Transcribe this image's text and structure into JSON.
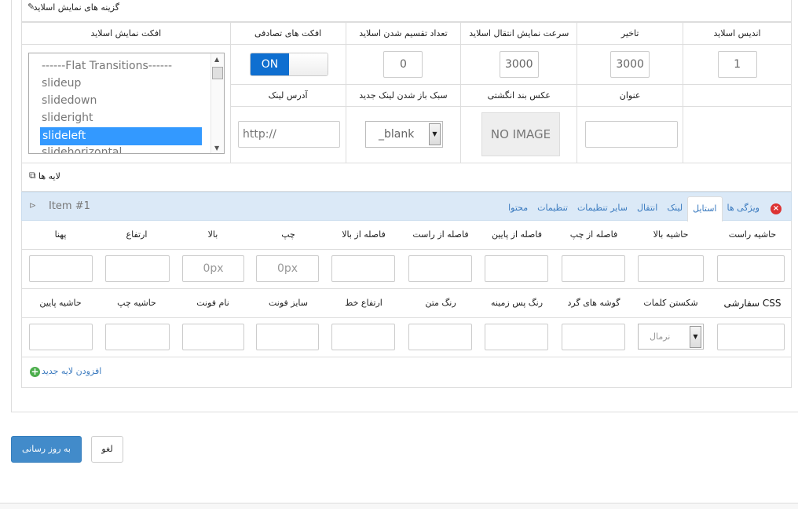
{
  "section": {
    "title": "گزینه های نمایش اسلاید",
    "icon": "wrench-icon"
  },
  "top_headers": [
    "اندیس اسلاید",
    "تاخیر",
    "سرعت نمایش انتقال اسلاید",
    "تعداد تقسیم شدن اسلاید",
    "افکت های تصادفی",
    "افکت نمایش اسلاید"
  ],
  "top_values": {
    "slide_index": "1",
    "delay": "3000",
    "transition_speed": "3000",
    "slices": "0"
  },
  "toggle": {
    "on_label": "ON"
  },
  "effects_list": [
    "------Flat Transitions------",
    "slideup",
    "slidedown",
    "slideright",
    "slideleft",
    "slidehorizontal"
  ],
  "effects_selected": "slideleft",
  "second_headers": [
    "عنوان",
    "عکس بند انگشتی",
    "سبک باز شدن لینک جدید",
    "آدرس لینک"
  ],
  "second_values": {
    "title": "",
    "thumbnail": "NO IMAGE",
    "link_target": "_blank",
    "link_placeholder": "http://"
  },
  "layers": {
    "label": "لایه ها"
  },
  "item": {
    "name": "Item #1",
    "tabs": [
      "ویژگی ها",
      "استایل",
      "لینک",
      "انتقال",
      "سایر تنظیمات",
      "تنظیمات",
      "محتوا"
    ],
    "active_tab": "استایل"
  },
  "style_row1": [
    "حاشیه راست",
    "حاشیه بالا",
    "فاصله از چپ",
    "فاصله از پایین",
    "فاصله از راست",
    "فاصله از بالا",
    "چپ",
    "بالا",
    "ارتفاع",
    "پهنا"
  ],
  "style_row1_values": [
    "",
    "",
    "",
    "",
    "",
    "",
    "0px",
    "0px",
    "",
    ""
  ],
  "style_row2": [
    "CSS سفارشی",
    "شکستن کلمات",
    "گوشه های گرد",
    "رنگ پس زمینه",
    "رنگ متن",
    "ارتفاع خط",
    "سایز فونت",
    "نام فونت",
    "حاشیه چپ",
    "حاشیه پایین"
  ],
  "word_break_value": "نرمال",
  "add_layer": "افزودن لایه جدید",
  "buttons": {
    "update": "به روز رسانی",
    "cancel": "لغو"
  },
  "colors": {
    "primary": "#428bca",
    "toggle_on": "#0f6fd0",
    "item_bar": "#dbe9f7",
    "selection": "#3399ff"
  }
}
